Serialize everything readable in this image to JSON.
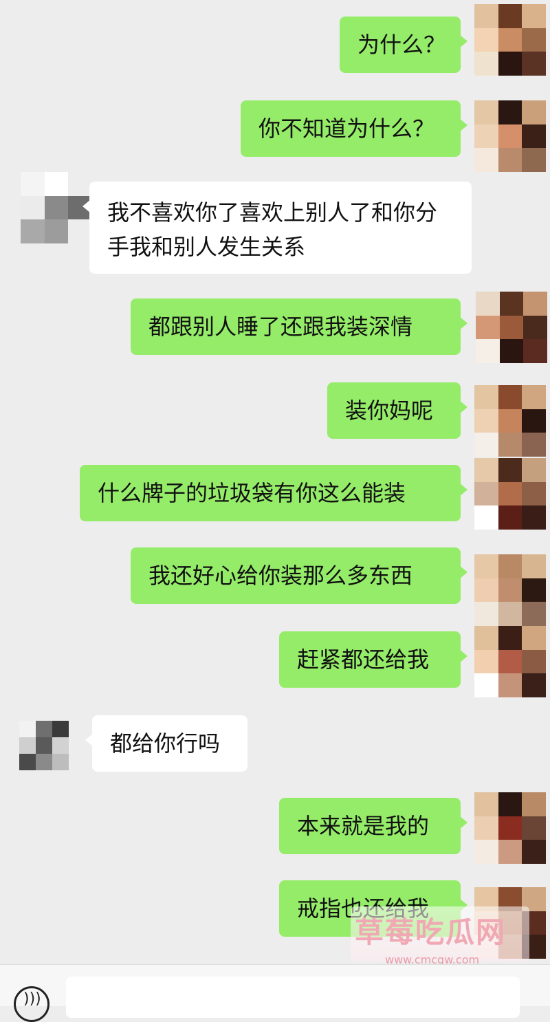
{
  "messages": [
    {
      "side": "right",
      "text": "为什么？"
    },
    {
      "side": "right",
      "text": "你不知道为什么？"
    },
    {
      "side": "left",
      "text": "我不喜欢你了喜欢上别人了和你分手我和别人发生关系"
    },
    {
      "side": "right",
      "text": "都跟别人睡了还跟我装深情"
    },
    {
      "side": "right",
      "text": "装你妈呢"
    },
    {
      "side": "right",
      "text": "什么牌子的垃圾袋有你这么能装"
    },
    {
      "side": "right",
      "text": "我还好心给你装那么多东西"
    },
    {
      "side": "right",
      "text": "赶紧都还给我"
    },
    {
      "side": "left",
      "text": "都给你行吗"
    },
    {
      "side": "right",
      "text": "本来就是我的"
    },
    {
      "side": "right",
      "text": "戒指也还给我"
    }
  ],
  "watermark": {
    "title": "草莓吃瓜网",
    "url": "www.cmcgw.com"
  },
  "icons": {
    "voice": "voice-icon"
  }
}
